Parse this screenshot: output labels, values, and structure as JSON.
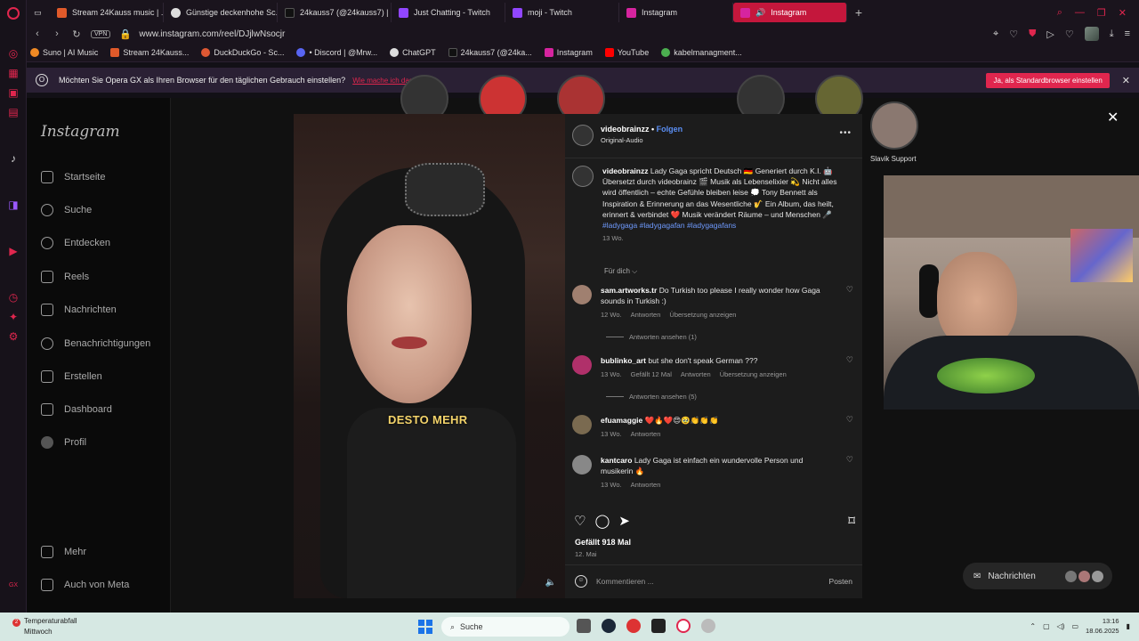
{
  "browser": {
    "tabs": [
      {
        "label": "Stream 24Kauss music | ...",
        "color": "#e05a2a"
      },
      {
        "label": "Günstige deckenhohe Sc...",
        "color": "#dddddd"
      },
      {
        "label": "24kauss7 (@24kauss7) | ...",
        "color": "#111111"
      },
      {
        "label": "Just Chatting - Twitch",
        "color": "#9146ff"
      },
      {
        "label": "moji - Twitch",
        "color": "#9146ff"
      },
      {
        "label": "Instagram",
        "color": "#d6249f"
      },
      {
        "label": "Instagram",
        "color": "#d6249f",
        "active": true
      }
    ],
    "url": "www.instagram.com/reel/DJjlwNsocjr",
    "vpn_label": "VPN",
    "bookmarks": [
      {
        "label": "Suno | AI Music",
        "color": "#f08a24"
      },
      {
        "label": "Stream 24Kauss...",
        "color": "#e05a2a"
      },
      {
        "label": "DuckDuckGo - Sc...",
        "color": "#de5833"
      },
      {
        "label": "• Discord | @Mrw...",
        "color": "#5865f2"
      },
      {
        "label": "ChatGPT",
        "color": "#dddddd"
      },
      {
        "label": "24kauss7 (@24ka...",
        "color": "#111111"
      },
      {
        "label": "Instagram",
        "color": "#d6249f"
      },
      {
        "label": "YouTube",
        "color": "#ff0000"
      },
      {
        "label": "kabelmanagment...",
        "color": "#4caf50"
      }
    ],
    "infobar": {
      "message": "Möchten Sie Opera GX als Ihren Browser für den täglichen Gebrauch einstellen?",
      "link": "Wie mache ich das?",
      "button": "Ja, als Standardbrowser einstellen"
    }
  },
  "instagram": {
    "logo": "Instagram",
    "nav": [
      {
        "label": "Startseite",
        "icon": "home-icon"
      },
      {
        "label": "Suche",
        "icon": "search-icon"
      },
      {
        "label": "Entdecken",
        "icon": "compass-icon"
      },
      {
        "label": "Reels",
        "icon": "reels-icon"
      },
      {
        "label": "Nachrichten",
        "icon": "send-icon"
      },
      {
        "label": "Benachrichtigungen",
        "icon": "heart-icon"
      },
      {
        "label": "Erstellen",
        "icon": "plus-icon"
      },
      {
        "label": "Dashboard",
        "icon": "chart-icon"
      },
      {
        "label": "Profil",
        "icon": "avatar-icon"
      }
    ],
    "nav_bottom": [
      {
        "label": "Mehr",
        "icon": "menu-icon"
      },
      {
        "label": "Auch von Meta",
        "icon": "meta-icon"
      }
    ],
    "story_label": "Slavik Support",
    "video_caption": "DESTO MEHR",
    "post": {
      "username": "videobrainzz",
      "follow": "Folgen",
      "audio": "Original-Audio",
      "caption_user": "videobrainzz",
      "caption": "Lady Gaga spricht Deutsch 🇩🇪 Generiert durch K.I. 🤖 Übersetzt durch videobrainz 🎬 Musik als Lebenselixier 💫 Nicht alles wird öffentlich – echte Gefühle bleiben leise 💭 Tony Bennett als Inspiration & Erinnerung an das Wesentliche 🎷 Ein Album, das heilt, erinnert & verbindet ❤️ Musik verändert Räume – und Menschen 🎤",
      "tags": "#ladygaga #ladygagafan #ladygagafans",
      "caption_time": "13 Wo.",
      "sort_label": "Für dich ⌵",
      "comments": [
        {
          "user": "sam.artworks.tr",
          "text": "Do Turkish too please I really wonder how Gaga sounds in Turkish :)",
          "meta": [
            "12 Wo.",
            "Antworten",
            "Übersetzung anzeigen"
          ],
          "replies": "Antworten ansehen (1)",
          "avatar": "#a08070"
        },
        {
          "user": "bublinko_art",
          "text": "but she don't speak German ???",
          "meta": [
            "13 Wo.",
            "Gefällt 12 Mal",
            "Antworten",
            "Übersetzung anzeigen"
          ],
          "replies": "Antworten ansehen (5)",
          "avatar": "#b0306a"
        },
        {
          "user": "efuamaggie",
          "text": "❤️🔥❤️😍🥹👏👏👏",
          "meta": [
            "13 Wo.",
            "Antworten"
          ],
          "replies": "",
          "avatar": "#7a6a50"
        },
        {
          "user": "kantcaro",
          "text": "Lady Gaga ist einfach ein wundervolle Person und musikerin 🔥",
          "meta": [
            "13 Wo.",
            "Antworten"
          ],
          "replies": "",
          "avatar": "#888888"
        }
      ],
      "likes": "Gefällt 918 Mal",
      "date": "12. Mai",
      "comment_placeholder": "Kommentieren ...",
      "post_button": "Posten"
    },
    "messages_label": "Nachrichten"
  },
  "taskbar": {
    "weather_title": "Temperaturabfall",
    "weather_sub": "Mittwoch",
    "weather_badge": "2",
    "search": "Suche",
    "time": "13:16",
    "date": "18.06.2025"
  }
}
